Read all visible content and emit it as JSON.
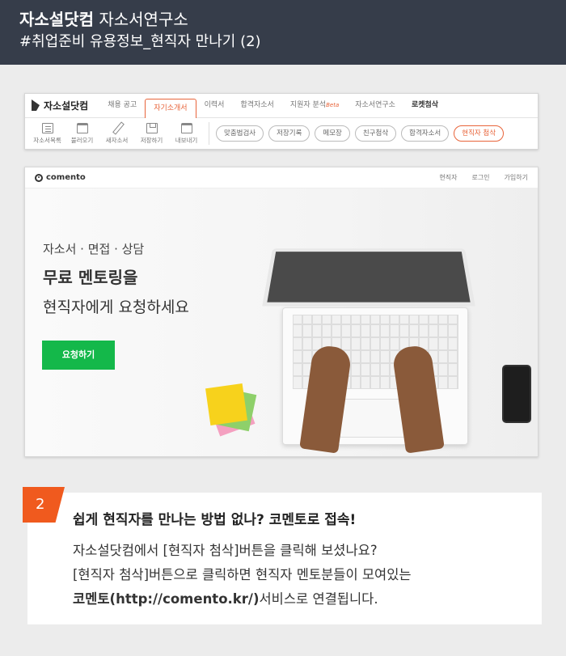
{
  "header": {
    "brand": "자소설닷컴",
    "subtitle": "자소서연구소",
    "line2": "#취업준비 유용정보_현직자 만나기 (2)",
    "bg_color": "#363d4a"
  },
  "jasoseol": {
    "logo": "자소설닷컴",
    "nav": [
      {
        "label": "채용 공고",
        "active": false
      },
      {
        "label": "자기소개서",
        "active": true
      },
      {
        "label": "이력서",
        "active": false
      },
      {
        "label": "합격자소서",
        "active": false
      },
      {
        "label": "지원자 분석",
        "badge": "Beta",
        "active": false
      },
      {
        "label": "자소서연구소",
        "active": false
      },
      {
        "label": "로켓첨삭",
        "active": false,
        "bold": true
      }
    ],
    "tools": [
      "자소서목록",
      "불러오기",
      "새자소서",
      "저장하기",
      "내보내기"
    ],
    "pills": [
      "맞춤법검사",
      "저장기록",
      "메모장",
      "친구첨삭",
      "합격자소서",
      "현직자 첨삭"
    ],
    "accent_color": "#e8643a"
  },
  "comento": {
    "logo": "comento",
    "nav_links": [
      "현직자",
      "로그인",
      "가입하기"
    ],
    "hero_small": "자소서 · 면접 · 상담",
    "hero_big": "무료 멘토링을",
    "hero_mid": "현직자에게 요청하세요",
    "cta_label": "요청하기",
    "cta_color": "#14b84a"
  },
  "caption": {
    "number": "2",
    "title": "쉽게 현직자를 만나는 방법 없나? 코멘토로 접속!",
    "body_line1": "자소설닷컴에서 [현직자 첨삭]버튼을 클릭해 보셨나요?",
    "body_line2": "[현직자 첨삭]버튼으로 클릭하면 현직자 멘토분들이 모여있는",
    "body_line3_bold": "코멘토(http://comento.kr/)",
    "body_line3_rest": "서비스로 연결됩니다.",
    "badge_color": "#f05a1e"
  }
}
